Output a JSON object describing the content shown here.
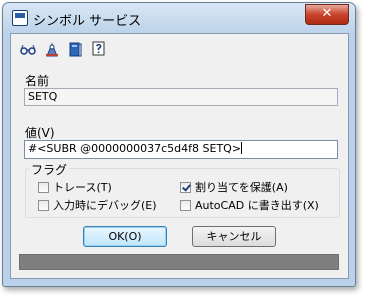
{
  "window": {
    "title": "シンボル サービス",
    "close_label": "✕"
  },
  "toolbar": {
    "icons": [
      "glasses-icon",
      "inspect-icon",
      "book-icon",
      "help-icon"
    ]
  },
  "name_field": {
    "label": "名前",
    "value": "SETQ"
  },
  "value_field": {
    "label": "値(V)",
    "value": "#<SUBR @0000000037c5d4f8 SETQ>"
  },
  "flags": {
    "legend": "フラグ",
    "trace": {
      "label": "トレース(T)",
      "checked": false
    },
    "protect": {
      "label": "割り当てを保護(A)",
      "checked": true
    },
    "debug_on_entry": {
      "label": "入力時にデバッグ(E)",
      "checked": false
    },
    "export_autocad": {
      "label": "AutoCAD に書き出す(X)",
      "checked": false
    }
  },
  "buttons": {
    "ok": "OK(O)",
    "cancel": "キャンセル"
  },
  "colors": {
    "frame": "#b9d1ea",
    "client": "#f0f0f0",
    "statusbar": "#7f7f7f",
    "close": "#c7442c"
  }
}
